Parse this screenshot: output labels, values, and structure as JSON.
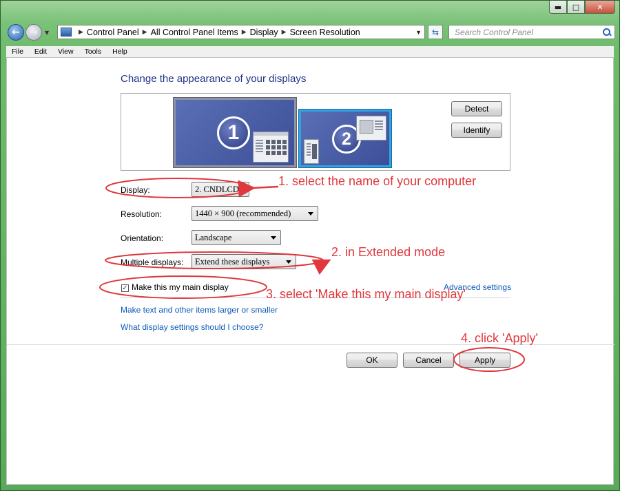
{
  "window": {
    "buttons": {
      "minimize": "▬",
      "maximize": "□",
      "close": "✕"
    }
  },
  "address_bar": {
    "crumbs": [
      "Control Panel",
      "All Control Panel Items",
      "Display",
      "Screen Resolution"
    ],
    "search_placeholder": "Search Control Panel"
  },
  "menu": [
    "File",
    "Edit",
    "View",
    "Tools",
    "Help"
  ],
  "main": {
    "title": "Change the appearance of your displays",
    "monitors": [
      "1",
      "2"
    ],
    "detect_label": "Detect",
    "identify_label": "Identify",
    "display": {
      "label": "Display:",
      "value": "2. CNDLCD"
    },
    "resolution": {
      "label": "Resolution:",
      "value": "1440 × 900 (recommended)"
    },
    "orientation": {
      "label": "Orientation:",
      "value": "Landscape"
    },
    "multiple": {
      "label": "Multiple displays:",
      "value": "Extend these displays"
    },
    "main_display": {
      "label": "Make this my main display",
      "checked": true
    },
    "advanced_link": "Advanced settings",
    "text_size_link": "Make text and other items larger or smaller",
    "help_link": "What display settings should I choose?",
    "ok_label": "OK",
    "cancel_label": "Cancel",
    "apply_label": "Apply"
  },
  "annotations": {
    "step1": "1. select the name of your computer",
    "step2": "2. in Extended mode",
    "step3": "3. select 'Make this my main display'",
    "step4": "4. click 'Apply'",
    "color": "#e0383c"
  }
}
